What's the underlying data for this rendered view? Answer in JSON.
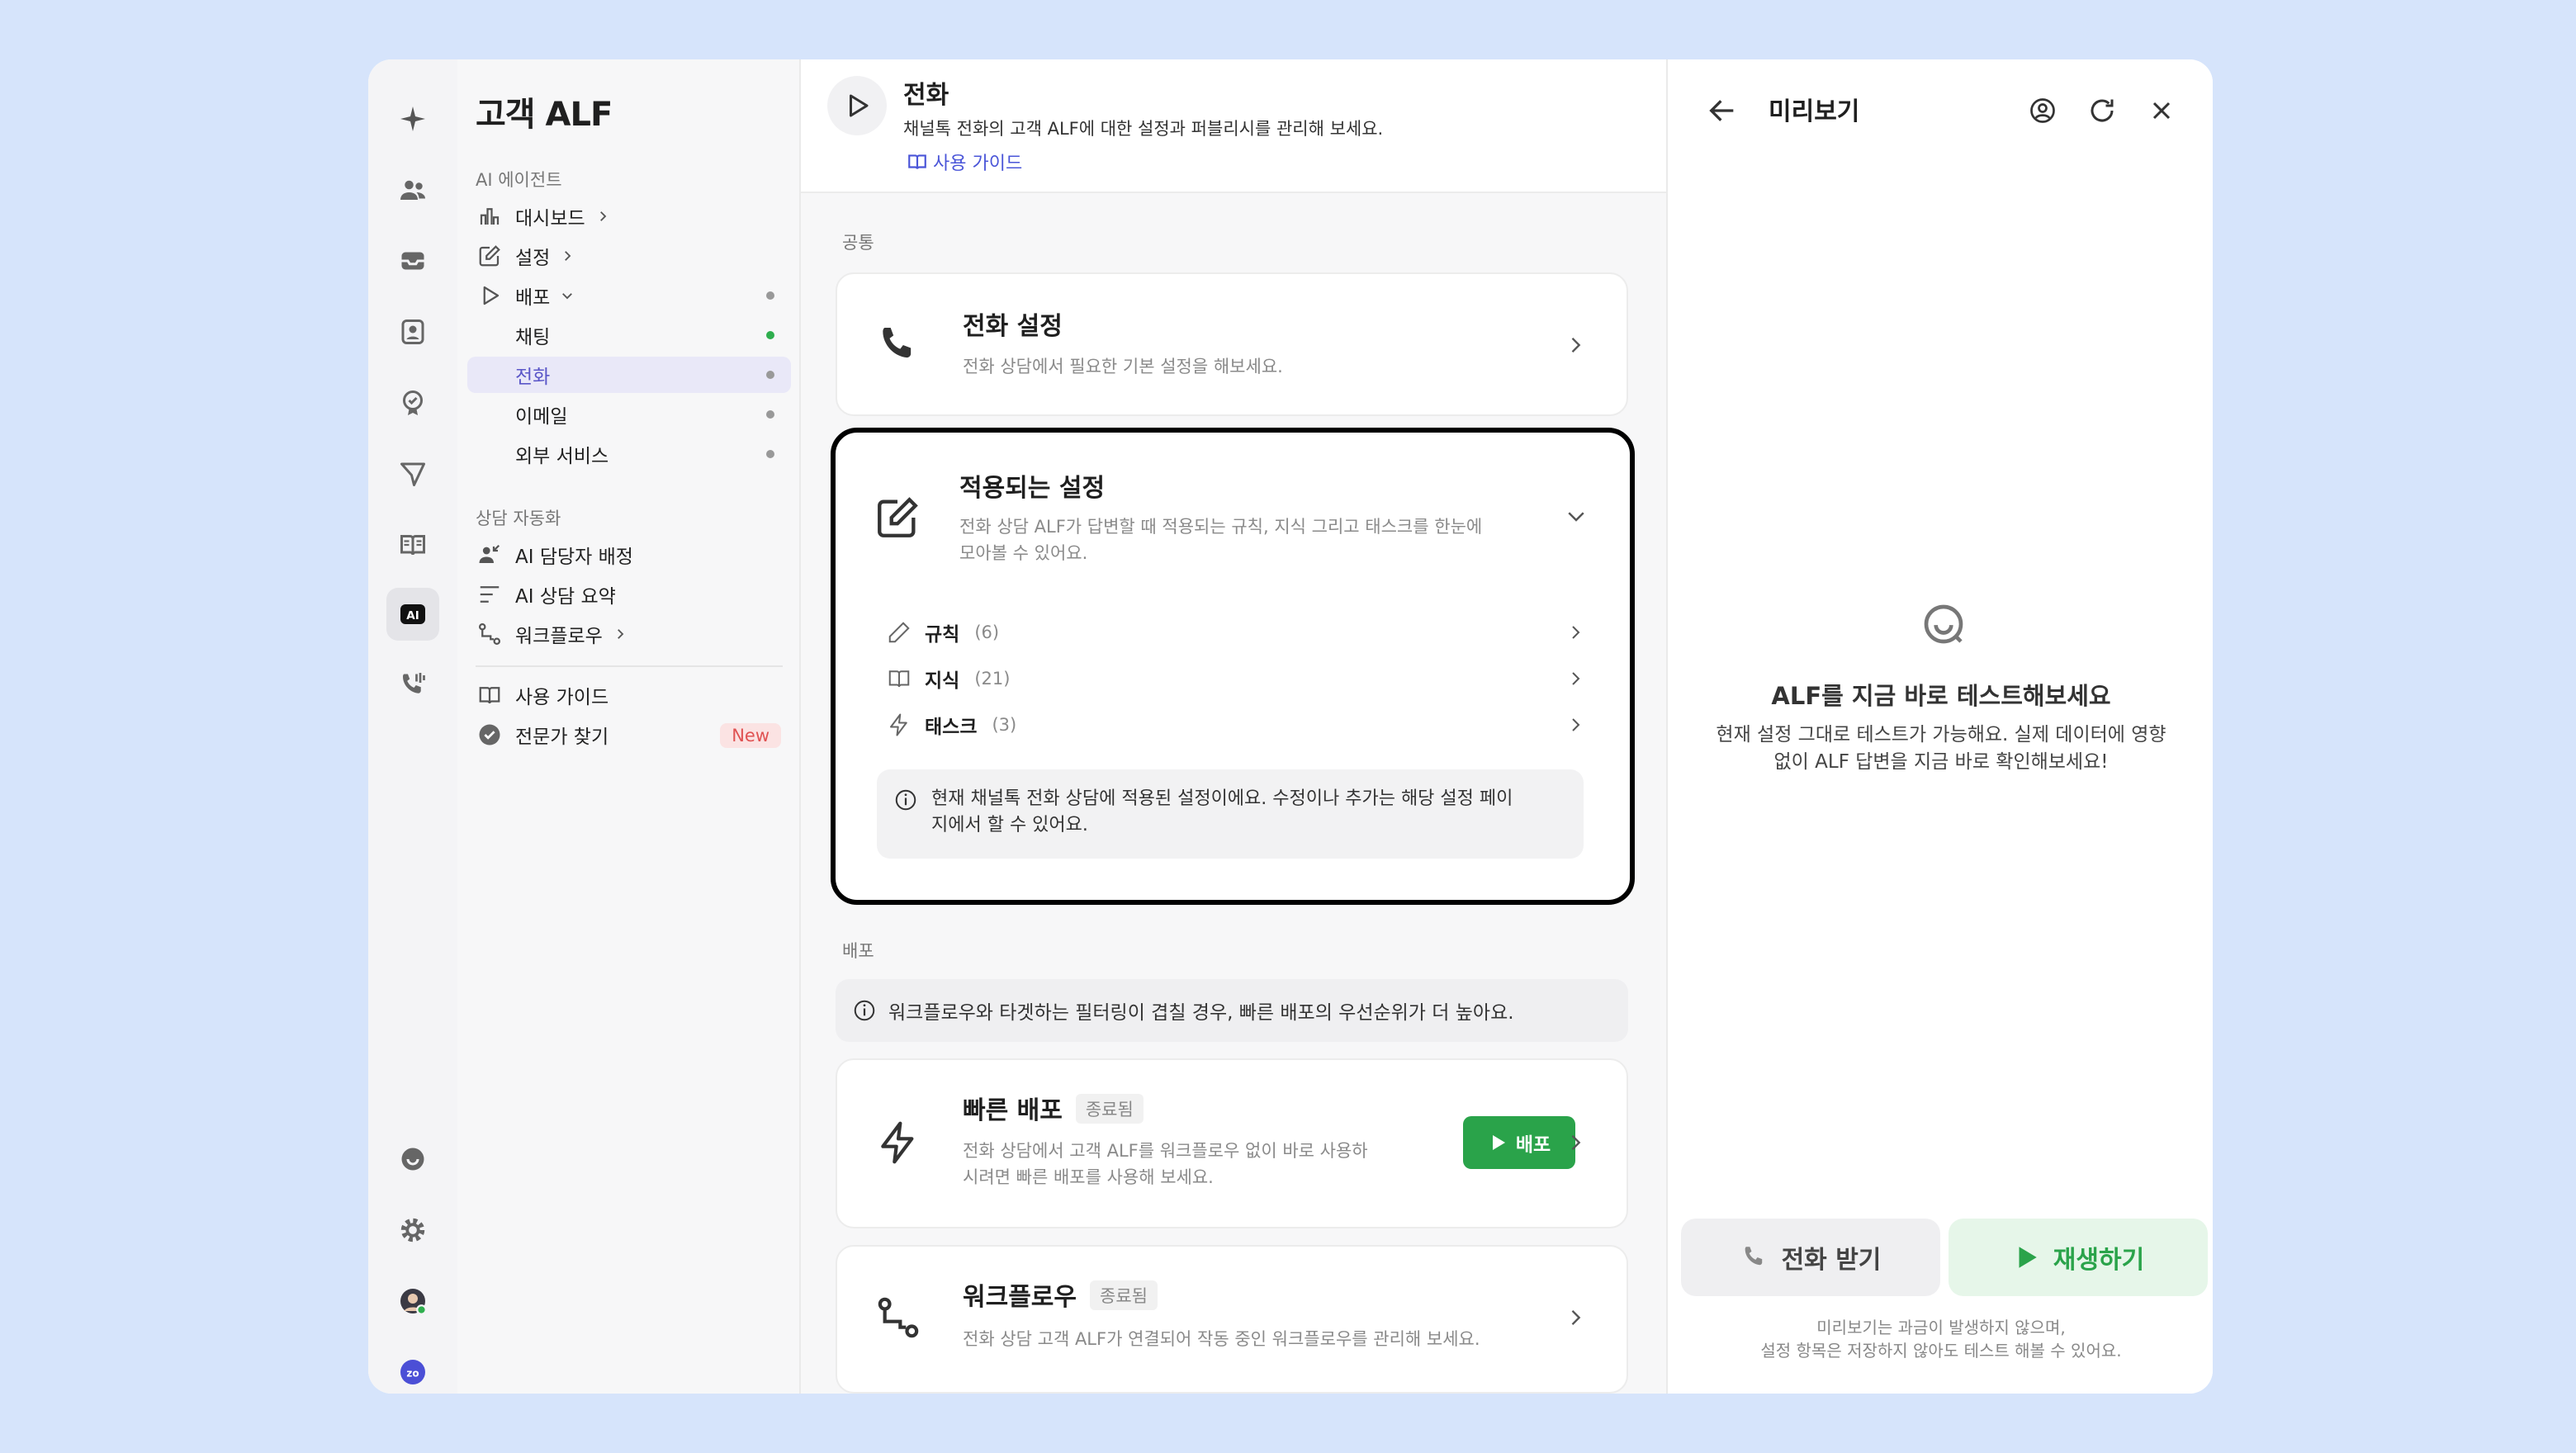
{
  "nav": {
    "title": "고객 ALF",
    "sections": {
      "agent": "AI 에이전트",
      "automation": "상담 자동화"
    },
    "items": {
      "dashboard": "대시보드",
      "settings": "설정",
      "deploy": "배포",
      "chat": "채팅",
      "phone": "전화",
      "email": "이메일",
      "external": "외부 서비스",
      "ai_assign": "AI 담당자 배정",
      "ai_summary": "AI 상담 요약",
      "workflow": "워크플로우",
      "guide": "사용 가이드",
      "expert": "전문가 찾기"
    },
    "new_badge": "New"
  },
  "main": {
    "header": {
      "title": "전화",
      "desc": "채널톡 전화의 고객 ALF에 대한 설정과 퍼블리시를 관리해 보세요.",
      "guide": "사용 가이드"
    },
    "common_label": "공통",
    "phone_settings": {
      "title": "전화 설정",
      "desc": "전화 상담에서 필요한 기본 설정을 해보세요."
    },
    "applied": {
      "title": "적용되는 설정",
      "desc1": "전화 상담 ALF가 답변할 때 적용되는 규칙, 지식 그리고 태스크를 한눈에",
      "desc2": "모아볼 수 있어요.",
      "rows": [
        {
          "label": "규칙",
          "count": "(6)"
        },
        {
          "label": "지식",
          "count": "(21)"
        },
        {
          "label": "태스크",
          "count": "(3)"
        }
      ],
      "info1": "현재 채널톡 전화 상담에 적용된 설정이에요. 수정이나 추가는 해당 설정 페이",
      "info2": "지에서 할 수 있어요."
    },
    "deploy_label": "배포",
    "deploy_info": "워크플로우와 타겟하는 필터링이 겹칠 경우, 빠른 배포의 우선순위가 더 높아요.",
    "quick": {
      "title": "빠른 배포",
      "tag": "종료됨",
      "desc1": "전화 상담에서 고객 ALF를 워크플로우 없이 바로 사용하",
      "desc2": "시려면 빠른 배포를 사용해 보세요.",
      "button": "배포"
    },
    "workflow": {
      "title": "워크플로우",
      "tag": "종료됨",
      "desc": "전화 상담 고객 ALF가 연결되어 작동 중인 워크플로우를 관리해 보세요."
    }
  },
  "preview": {
    "title": "미리보기",
    "heading": "ALF를 지금 바로 테스트해보세요",
    "desc1": "현재 설정 그대로 테스트가 가능해요. 실제 데이터에 영향",
    "desc2": "없이 ALF 답변을 지금 바로 확인해보세요!",
    "call_button": "전화 받기",
    "play_button": "재생하기",
    "note1": "미리보기는 과금이 발생하지 않으며,",
    "note2": "설정 항목은 저장하지 않아도 테스트 해볼 수 있어요."
  },
  "colors": {
    "accent": "#5a56c8",
    "green": "#2aa34a",
    "background": "#d6e4fb"
  }
}
